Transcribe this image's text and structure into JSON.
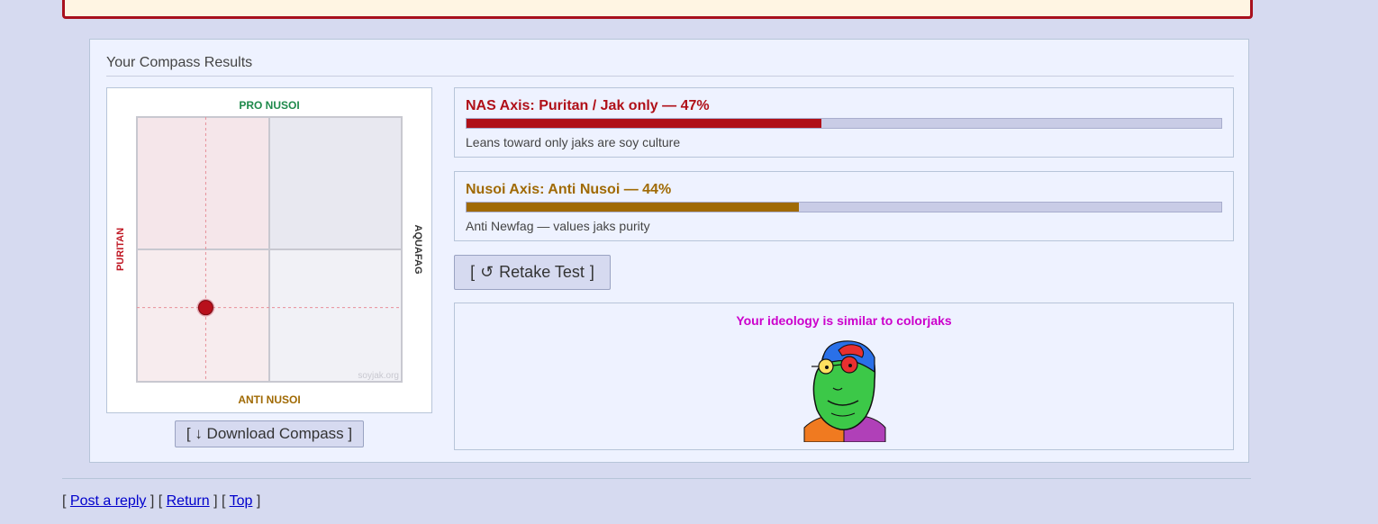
{
  "colors": {
    "page_bg": "#d6daf0",
    "panel_bg": "#eef2ff",
    "nas_color": "#b01018",
    "nusoi_color": "#a06a04",
    "pro_nusoi_color": "#1f8a4c",
    "puritan_color": "#c01824",
    "similar_title_color": "#cc00cc",
    "link_color": "#0000cc"
  },
  "results": {
    "title": "Your Compass Results"
  },
  "compass": {
    "label_top": "PRO NUSOI",
    "label_bottom": "ANTI NUSOI",
    "label_left": "PURITAN",
    "label_right": "AQUAFAG",
    "watermark": "soyjak.org",
    "marker": {
      "x_fraction": 0.26,
      "y_fraction": 0.72
    },
    "download_label": "[ ↓ Download Compass ]"
  },
  "axes": [
    {
      "title": "NAS Axis: Puritan / Jak only — 47%",
      "percent": 47,
      "description": "Leans toward only jaks are soy culture",
      "color": "#b01018"
    },
    {
      "title": "Nusoi Axis: Anti Nusoi — 44%",
      "percent": 44,
      "description": "Anti Newfag — values jaks purity",
      "color": "#a06a04"
    }
  ],
  "retake": {
    "label": "Retake Test",
    "icon": "retake-icon"
  },
  "similar": {
    "title": "Your ideology is similar to colorjaks",
    "image_icon": "colorjak-face"
  },
  "footer": {
    "post_reply": "Post a reply",
    "return": "Return",
    "top": "Top"
  }
}
